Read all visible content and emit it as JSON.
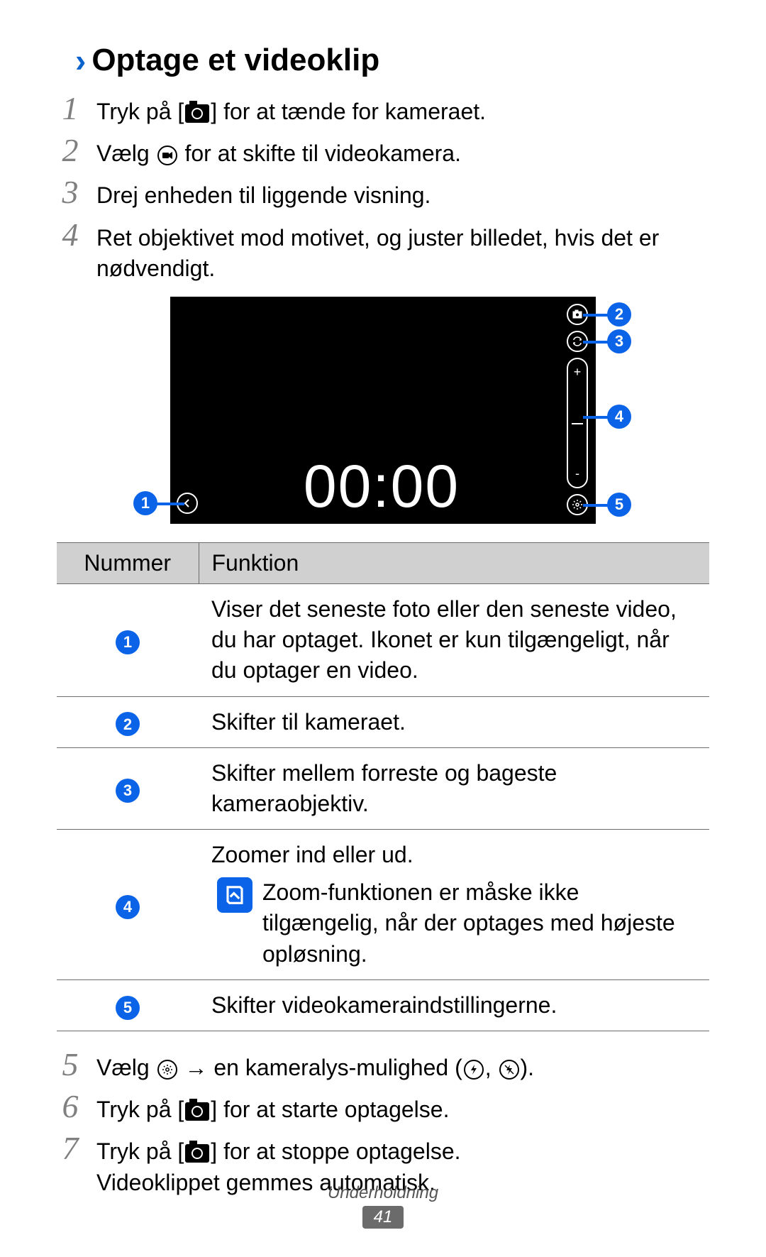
{
  "heading": {
    "chevron": "›",
    "title": "Optage et videoklip"
  },
  "steps": {
    "s1": {
      "num": "1",
      "pre": "Tryk på [",
      "post": "] for at tænde for kameraet."
    },
    "s2": {
      "num": "2",
      "pre": "Vælg ",
      "post": " for at skifte til videokamera."
    },
    "s3": {
      "num": "3",
      "text": "Drej enheden til liggende visning."
    },
    "s4": {
      "num": "4",
      "text": "Ret objektivet mod motivet, og juster billedet, hvis det er nødvendigt."
    },
    "s5": {
      "num": "5",
      "pre": "Vælg ",
      "mid": " → en kameralys-mulighed (",
      "sep": ", ",
      "post": ")."
    },
    "s6": {
      "num": "6",
      "pre": "Tryk på [",
      "post": "] for at starte optagelse."
    },
    "s7": {
      "num": "7",
      "pre": "Tryk på [",
      "post1": "] for at stoppe optagelse.",
      "line2": "Videoklippet gemmes automatisk."
    }
  },
  "viewfinder": {
    "timer": "00:00",
    "zoom_plus": "+",
    "zoom_minus": "-"
  },
  "callouts": {
    "c1": "1",
    "c2": "2",
    "c3": "3",
    "c4": "4",
    "c5": "5"
  },
  "table": {
    "headers": {
      "num": "Nummer",
      "func": "Funktion"
    },
    "rows": {
      "r1": {
        "n": "1",
        "desc": "Viser det seneste foto eller den seneste video, du har optaget. Ikonet er kun tilgængeligt, når du optager en video."
      },
      "r2": {
        "n": "2",
        "desc": "Skifter til kameraet."
      },
      "r3": {
        "n": "3",
        "desc": "Skifter mellem forreste og bageste kameraobjektiv."
      },
      "r4": {
        "n": "4",
        "line1": "Zoomer ind eller ud.",
        "note": "Zoom-funktionen er måske ikke tilgængelig, når der optages med højeste opløsning."
      },
      "r5": {
        "n": "5",
        "desc": "Skifter videokameraindstillingerne."
      }
    }
  },
  "footer": {
    "section": "Underholdning",
    "page": "41"
  }
}
